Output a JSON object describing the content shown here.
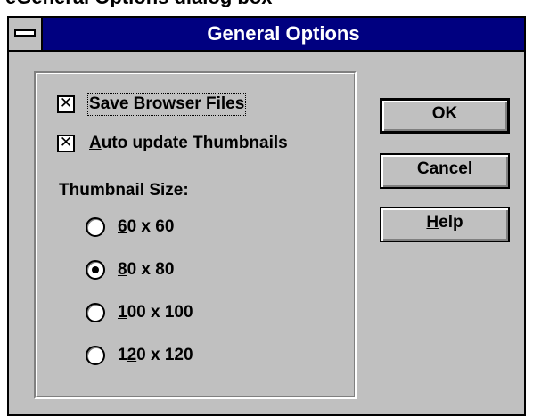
{
  "page_caption": "eGeneral Options dialog box",
  "window": {
    "title": "General Options"
  },
  "options": {
    "save_browser_files": {
      "label_accel": "S",
      "label_rest": "ave Browser Files",
      "checked": true,
      "mark": "✕"
    },
    "auto_update_thumbnails": {
      "label_accel": "A",
      "label_rest": "uto update Thumbnails",
      "checked": true,
      "mark": "✕"
    }
  },
  "thumbnail_size": {
    "heading": "Thumbnail Size:",
    "selected_index": 1,
    "options": [
      {
        "pre": "",
        "accel": "6",
        "post": "0 x 60"
      },
      {
        "pre": "",
        "accel": "8",
        "post": "0 x 80"
      },
      {
        "pre": "",
        "accel": "1",
        "post": "00 x 100"
      },
      {
        "pre": "1",
        "accel": "2",
        "post": "0 x 120"
      }
    ]
  },
  "buttons": {
    "ok": "OK",
    "cancel": "Cancel",
    "help_accel": "H",
    "help_rest": "elp"
  }
}
